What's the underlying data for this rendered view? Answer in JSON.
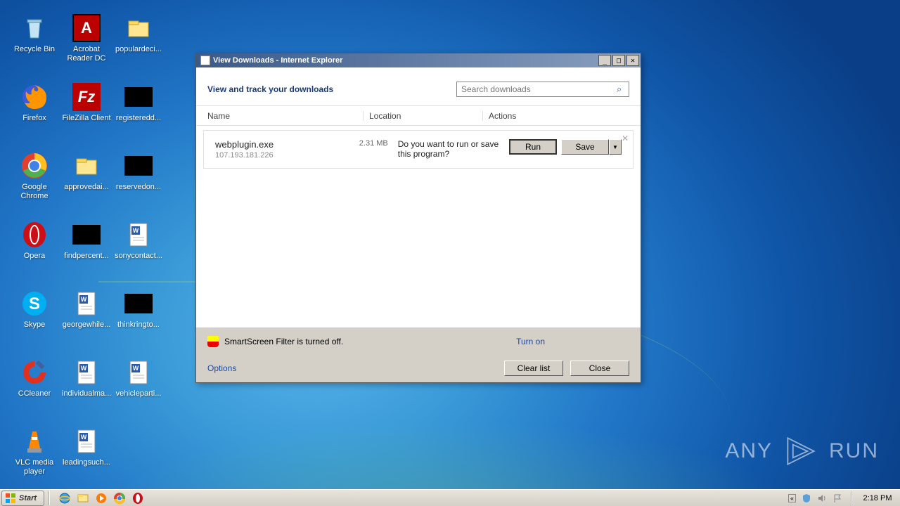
{
  "desktop": {
    "icons": [
      {
        "label": "Recycle Bin",
        "icon": "recyclebin"
      },
      {
        "label": "Acrobat Reader DC",
        "icon": "acrobat"
      },
      {
        "label": "populardeci...",
        "icon": "folder"
      },
      {
        "label": "Firefox",
        "icon": "firefox"
      },
      {
        "label": "FileZilla Client",
        "icon": "filezilla"
      },
      {
        "label": "registeredd...",
        "icon": "black"
      },
      {
        "label": "Google Chrome",
        "icon": "chrome"
      },
      {
        "label": "approvedai...",
        "icon": "folder"
      },
      {
        "label": "reservedon...",
        "icon": "black"
      },
      {
        "label": "Opera",
        "icon": "opera"
      },
      {
        "label": "findpercent...",
        "icon": "black"
      },
      {
        "label": "sonycontact...",
        "icon": "word"
      },
      {
        "label": "Skype",
        "icon": "skype"
      },
      {
        "label": "georgewhile...",
        "icon": "word"
      },
      {
        "label": "thinkringto...",
        "icon": "black"
      },
      {
        "label": "CCleaner",
        "icon": "ccleaner"
      },
      {
        "label": "individualma...",
        "icon": "word"
      },
      {
        "label": "vehicleparti...",
        "icon": "word"
      },
      {
        "label": "VLC media player",
        "icon": "vlc"
      },
      {
        "label": "leadingsuch...",
        "icon": "word"
      }
    ]
  },
  "dialog": {
    "title": "View Downloads - Internet Explorer",
    "header_title": "View and track your downloads",
    "search_placeholder": "Search downloads",
    "columns": {
      "name": "Name",
      "location": "Location",
      "actions": "Actions"
    },
    "row": {
      "filename": "webplugin.exe",
      "source": "107.193.181.226",
      "size": "2.31 MB",
      "prompt": "Do you want to run or save this program?",
      "run": "Run",
      "save": "Save"
    },
    "smartscreen_text": "SmartScreen Filter is turned off.",
    "smartscreen_link": "Turn on",
    "options": "Options",
    "clear": "Clear list",
    "close": "Close"
  },
  "taskbar": {
    "start": "Start",
    "clock": "2:18 PM"
  },
  "watermark": {
    "text": "ANY",
    "text2": "RUN"
  }
}
